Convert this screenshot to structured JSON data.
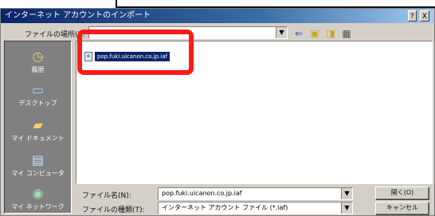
{
  "window": {
    "title": "インターネット アカウントのインポート",
    "help_label": "?",
    "close_label": "X"
  },
  "look_in": {
    "label": "ファイルの場所(I):",
    "value": ""
  },
  "places": [
    {
      "label": "履歴",
      "icon": "history-icon"
    },
    {
      "label": "デスクトップ",
      "icon": "desktop-icon"
    },
    {
      "label": "マイ ドキュメント",
      "icon": "my-documents-icon"
    },
    {
      "label": "マイ コンピュータ",
      "icon": "my-computer-icon"
    },
    {
      "label": "マイ ネットワーク",
      "icon": "my-network-icon"
    }
  ],
  "files": [
    {
      "name": "pop.fuki.uicanon.co.jp.iaf"
    }
  ],
  "filename": {
    "label": "ファイル名(N):",
    "value": "pop.fuki.uicanon.co.jp.iaf"
  },
  "filetype": {
    "label": "ファイルの種類(T):",
    "value": "インターネット アカウント ファイル (*.iaf)"
  },
  "buttons": {
    "open": "開く(O)",
    "cancel": "キャンセル"
  },
  "colors": {
    "highlight": "#ff1a1a",
    "selection": "#0a246a",
    "dialog_bg": "#d4d0c8"
  }
}
